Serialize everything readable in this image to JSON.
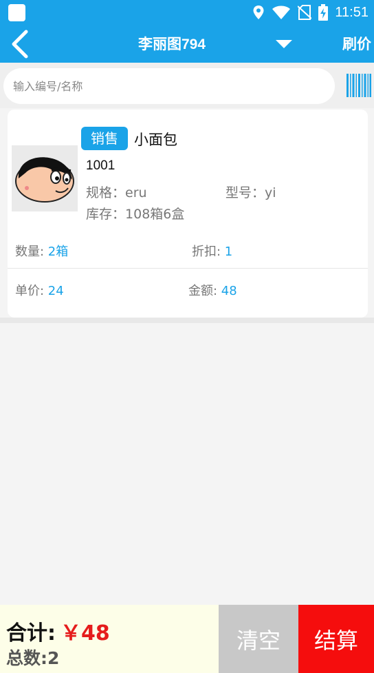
{
  "status_bar": {
    "time": "11:51",
    "icons": [
      "location-icon",
      "wifi-icon",
      "no-sim-icon",
      "battery-charging-icon"
    ]
  },
  "nav": {
    "title": "李丽图794",
    "refresh_label": "刷价"
  },
  "search": {
    "placeholder": "输入编号/名称",
    "value": ""
  },
  "product": {
    "badge": "销售",
    "name": "小面包",
    "code": "1001",
    "spec_label": "规格：",
    "spec_value": "eru",
    "model_label": "型号：",
    "model_value": "yi",
    "stock_label": "库存：",
    "stock_value": "108箱6盒",
    "qty_label": "数量: ",
    "qty_value": "2箱",
    "discount_label": "折扣: ",
    "discount_value": "1",
    "price_label": "单价: ",
    "price_value": "24",
    "amount_label": "金额: ",
    "amount_value": "48"
  },
  "footer": {
    "total_label": "合计:",
    "total_value": "￥48",
    "count_label": "总数:2",
    "clear_label": "清空",
    "checkout_label": "结算"
  },
  "colors": {
    "primary": "#1aa3e8",
    "danger": "#f50d0d",
    "total_red": "#e51c1c"
  }
}
